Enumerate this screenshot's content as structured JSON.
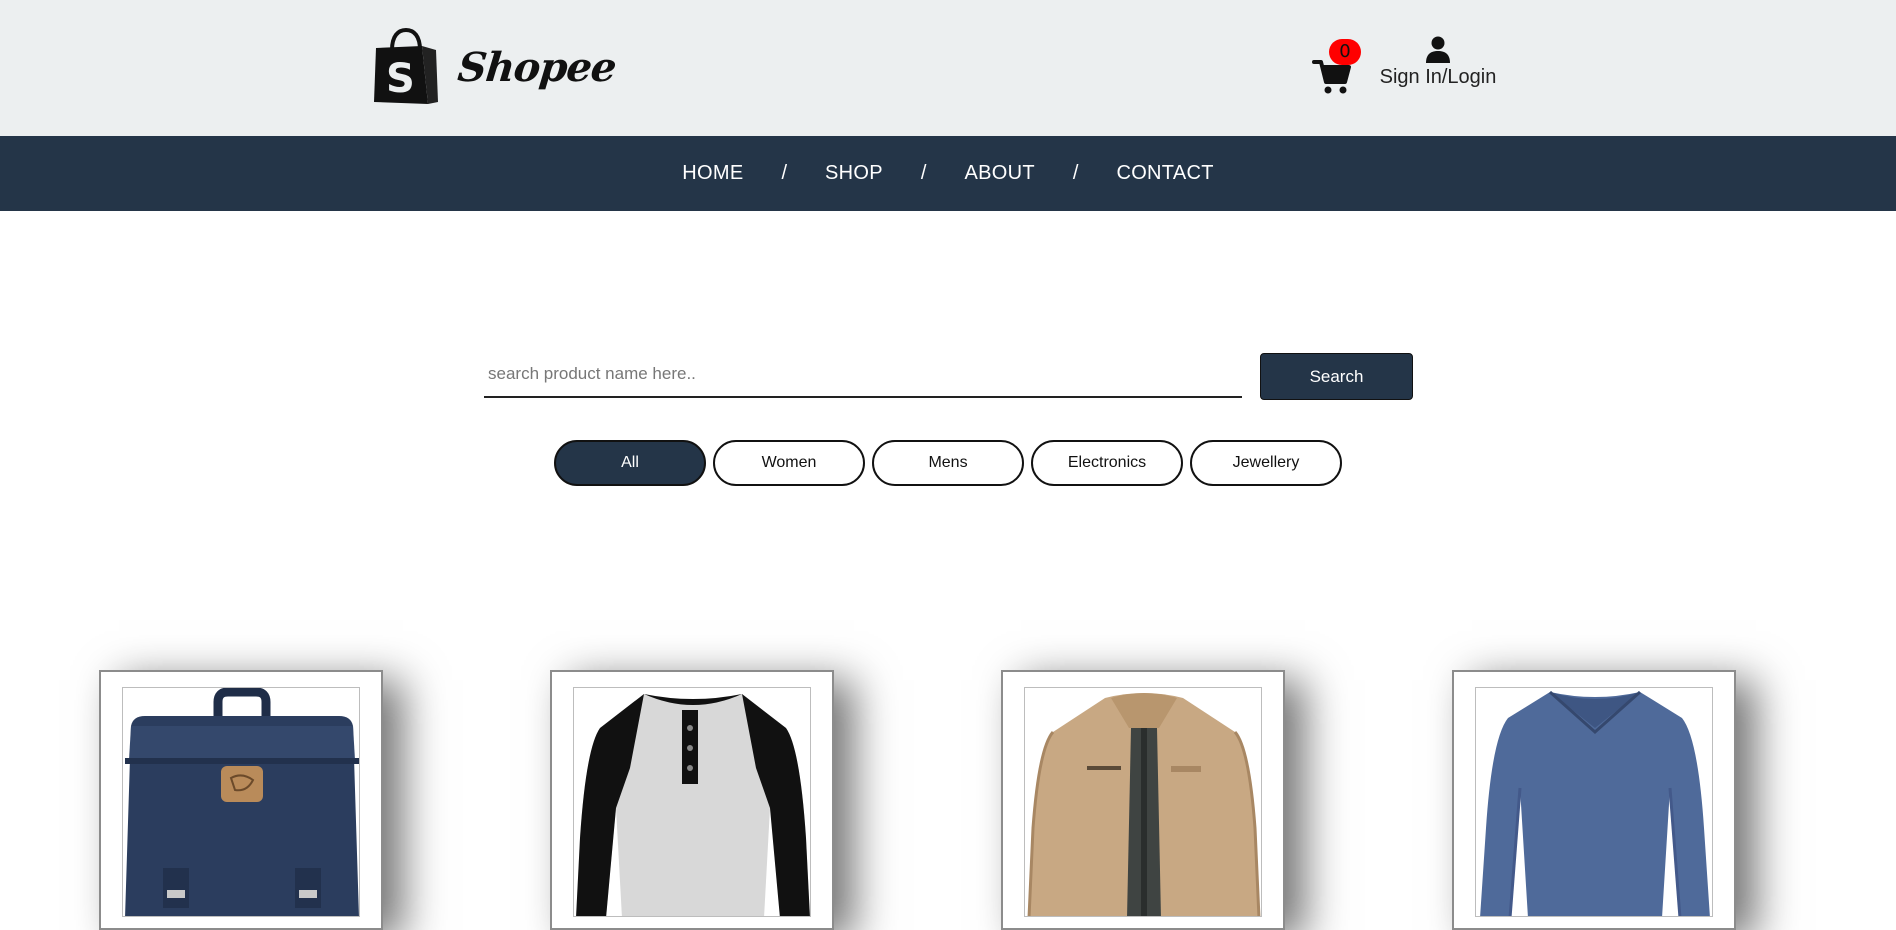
{
  "brand": {
    "name": "Shopee"
  },
  "header": {
    "cart_count": "0",
    "signin_label": "Sign In/Login"
  },
  "nav": {
    "items": [
      "HOME",
      "SHOP",
      "ABOUT",
      "CONTACT"
    ],
    "separator": "/"
  },
  "search": {
    "placeholder": "search product name here..",
    "value": "",
    "button_label": "Search"
  },
  "filters": {
    "items": [
      "All",
      "Women",
      "Mens",
      "Electronics",
      "Jewellery"
    ],
    "selected": "All"
  },
  "products": [
    {
      "icon": "backpack-image"
    },
    {
      "icon": "raglan-shirt-image"
    },
    {
      "icon": "jacket-image"
    },
    {
      "icon": "long-sleeve-shirt-image"
    }
  ],
  "colors": {
    "header_bg": "#eceff0",
    "nav_bg": "#243548",
    "accent": "#243548",
    "badge": "#ff0000"
  }
}
